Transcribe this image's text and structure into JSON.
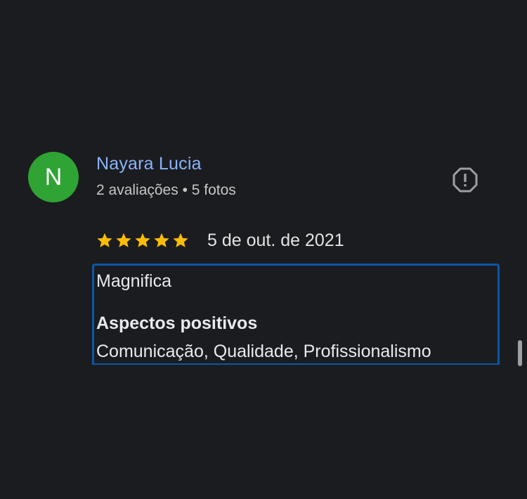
{
  "review": {
    "avatar_letter": "N",
    "avatar_color": "#2fa334",
    "reviewer_name": "Nayara Lucia",
    "reviewer_meta": "2 avaliações • 5 fotos",
    "rating": 5,
    "rating_max": 5,
    "star_color": "#fbbc04",
    "date": "5 de out. de 2021",
    "text": "Magnifica",
    "positives_heading": "Aspectos positivos",
    "positives": "Comunicação, Qualidade, Profissionalismo",
    "report_icon": "report-flag-icon",
    "highlight_color": "#0b57a8"
  }
}
